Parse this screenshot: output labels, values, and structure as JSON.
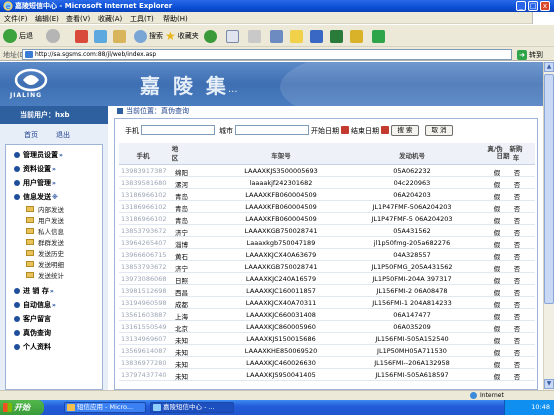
{
  "window": {
    "title": "嘉陵短信中心 - Microsoft Internet Explorer",
    "min": "_",
    "max": "□",
    "close": "x"
  },
  "menu": [
    "文件(F)",
    "编辑(E)",
    "查看(V)",
    "收藏(A)",
    "工具(T)",
    "帮助(H)"
  ],
  "toolbar": {
    "back": "后退",
    "search": "搜索",
    "favorites": "收藏夹"
  },
  "address": {
    "label": "地址(D)",
    "url": "http://sa.sgsms.com:88/jl/web/index.asp",
    "go": "转到"
  },
  "banner": {
    "logo_text": "JIALING",
    "brand": "嘉 陵 集",
    "dots": "..."
  },
  "sidebar": {
    "user": "当前用户：hxb",
    "home": "首页",
    "logout": "退出",
    "nav": [
      {
        "label": "管理员设置",
        "chev": "»"
      },
      {
        "label": "资料设置",
        "chev": "»"
      },
      {
        "label": "用户管理",
        "chev": "»"
      },
      {
        "label": "信息发送",
        "chev": "※"
      }
    ],
    "sub": [
      "内部发送",
      "用户发送",
      "私人信息",
      "群群发送",
      "发送历史",
      "发送明细",
      "发送统计"
    ],
    "nav2": [
      {
        "label": "进 销 存",
        "chev": "»"
      },
      {
        "label": "自动信息",
        "chev": "»"
      },
      {
        "label": "客户留言",
        "chev": ""
      },
      {
        "label": "真伪查询",
        "chev": ""
      },
      {
        "label": "个人资料",
        "chev": ""
      }
    ]
  },
  "main": {
    "crumb": "当前位置：真伪查询",
    "search": {
      "phone_label": "手机",
      "city_label": "城市",
      "start_label": "开始日期",
      "end_label": "结束日期",
      "search_btn": "搜 索",
      "cancel_btn": "取 消"
    },
    "columns": {
      "phone": "手机",
      "region": "地区",
      "vin": "车架号",
      "engine": "发动机号",
      "truth": "真/伪",
      "new": "新购车",
      "date": "日期"
    },
    "rows": [
      {
        "phone": "13983917387",
        "region": "绵阳",
        "vin": "LAAAXKJS3500005693",
        "engine": "05A062232",
        "truth": "假",
        "new": "否"
      },
      {
        "phone": "13839581680",
        "region": "漯河",
        "vin": "laaaakjf242301682",
        "engine": "04c220963",
        "truth": "假",
        "new": "否"
      },
      {
        "phone": "13186966102",
        "region": "青岛",
        "vin": "LAAAXKFB060004509",
        "engine": "06A204203",
        "truth": "假",
        "new": "否"
      },
      {
        "phone": "13186966102",
        "region": "青岛",
        "vin": "LAAAXKFB060004509",
        "engine": "JL1P47FMF-506A204203",
        "truth": "假",
        "new": "否"
      },
      {
        "phone": "13186966102",
        "region": "青岛",
        "vin": "LAAAXKFB060004509",
        "engine": "JL1P47FMF-5 06A204203",
        "truth": "假",
        "new": "否"
      },
      {
        "phone": "13853793672",
        "region": "济宁",
        "vin": "LAAAXKGB750028741",
        "engine": "05A431562",
        "truth": "假",
        "new": "否"
      },
      {
        "phone": "13964265407",
        "region": "淄博",
        "vin": "Laaaxkgb750047189",
        "engine": "jl1p50fmg-205a682276",
        "truth": "假",
        "new": "否"
      },
      {
        "phone": "13966606715",
        "region": "黄石",
        "vin": "LAAAXKJCX40A63679",
        "engine": "04A328557",
        "truth": "假",
        "new": "否"
      },
      {
        "phone": "13853793672",
        "region": "济宁",
        "vin": "LAAAXKGB750028741",
        "engine": "JL1P50FMG_205A431562",
        "truth": "假",
        "new": "否"
      },
      {
        "phone": "13973086068",
        "region": "日照",
        "vin": "LAAAXKJC240A16579",
        "engine": "JL1P50FMI-204A 397317",
        "truth": "假",
        "new": "否"
      },
      {
        "phone": "13981512698",
        "region": "西昌",
        "vin": "LAAAXKJC160011857",
        "engine": "JL156FMI-2 06A08478",
        "truth": "假",
        "new": "否"
      },
      {
        "phone": "13194960598",
        "region": "成都",
        "vin": "LAAAXKJCX40A70311",
        "engine": "JL156FMI-1 204A814233",
        "truth": "假",
        "new": "否"
      },
      {
        "phone": "13561603887",
        "region": "上海",
        "vin": "LAAAXKJC660031408",
        "engine": "06A147477",
        "truth": "假",
        "new": "否"
      },
      {
        "phone": "13161550549",
        "region": "北京",
        "vin": "LAAAXKJC860005960",
        "engine": "06A035209",
        "truth": "假",
        "new": "否"
      },
      {
        "phone": "13134969607",
        "region": "未知",
        "vin": "LAAAXKJS150015686",
        "engine": "JL156FMI-505A152540",
        "truth": "假",
        "new": "否"
      },
      {
        "phone": "13569614087",
        "region": "未知",
        "vin": "LAAAXKHE850069520",
        "engine": "JL1P50MH05A711530",
        "truth": "假",
        "new": "否"
      },
      {
        "phone": "13836977280",
        "region": "未知",
        "vin": "LAAAXKJC460026630",
        "engine": "JL156FMI--206A132958",
        "truth": "假",
        "new": "否"
      },
      {
        "phone": "13797437740",
        "region": "未知",
        "vin": "LAAAXKJS950041405",
        "engine": "JL156FMI-505A618597",
        "truth": "假",
        "new": "否"
      }
    ]
  },
  "status": {
    "zone": "Internet"
  },
  "taskbar": {
    "start": "开始",
    "tasks": [
      "短信应用 - Micro...",
      "嘉陵短信中心 - ..."
    ],
    "clock": "10:48"
  },
  "colors": {
    "titlebar": "#0b4fd6",
    "banner": "#3e6fb3",
    "sidebar_header": "#2e5f9e",
    "taskbar": "#245edb",
    "start": "#3a9a3a"
  }
}
